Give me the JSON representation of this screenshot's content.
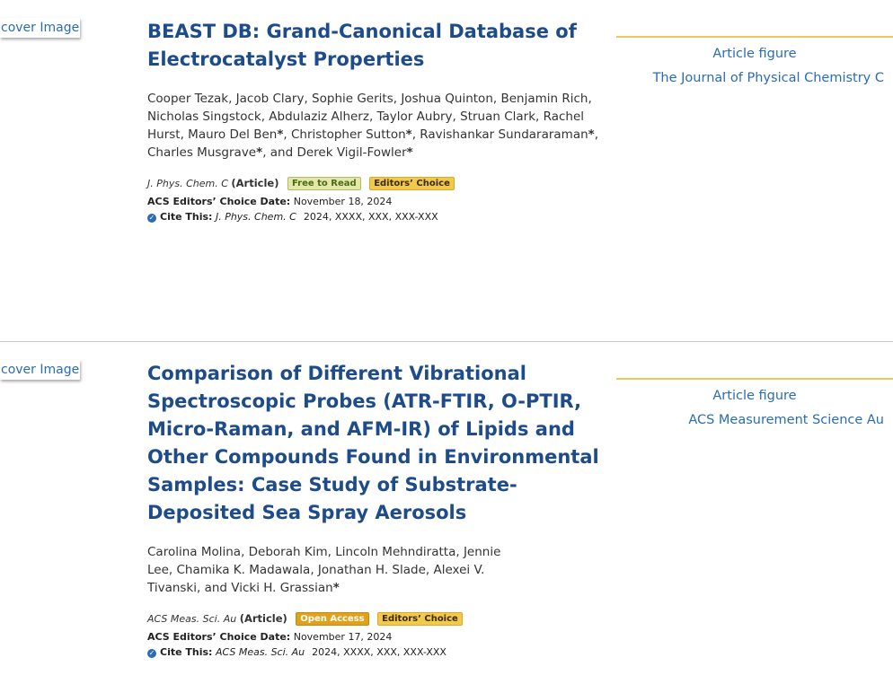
{
  "articles": [
    {
      "cover_alt": "cover Image",
      "title": "BEAST DB: Grand-Canonical Database of Electrocatalyst Properties",
      "authors": [
        {
          "text": "Cooper Tezak, Jacob Clary, Sophie Gerits, Joshua Quinton, Benjamin Rich, Nicholas Singstock, Abdulaziz Alherz, Taylor Aubry, Struan Clark, Rachel Hurst, Mauro Del Ben",
          "star": "*"
        },
        {
          "text": ", Christopher Sutton",
          "star": "*"
        },
        {
          "text": ", Ravishankar Sundararaman",
          "star": "*"
        },
        {
          "text": ", Charles Musgrave",
          "star": "*"
        },
        {
          "text": ", and Derek Vigil-Fowler",
          "star": "*"
        }
      ],
      "journal": "J. Phys. Chem. C",
      "article_type": "(Article)",
      "access_badge": "Free to Read",
      "access_kind": "free",
      "choice_badge": "Editors’ Choice",
      "ec_date_label": "ACS Editors’ Choice Date:",
      "ec_date": "November 18, 2024",
      "cite_label": "Cite This:",
      "cite_journal": "J. Phys. Chem. C",
      "cite_rest": "2024, XXXX, XXX, XXX-XXX",
      "figure_alt": "Article figure",
      "journal_img_alt": "The Journal of Physical Chemistry C"
    },
    {
      "cover_alt": "cover Image",
      "title": "Comparison of Different Vibrational Spectroscopic Probes (ATR-FTIR, O-PTIR, Micro-Raman, and AFM-IR) of Lipids and Other Compounds Found in Environmental Samples: Case Study of Substrate-Deposited Sea Spray Aerosols",
      "authors": [
        {
          "text": "Carolina Molina, Deborah Kim, Lincoln Mehndiratta, Jennie Lee, Chamika K. Madawala, Jonathan H. Slade, Alexei V. Tivanski, and Vicki H. Grassian",
          "star": "*"
        }
      ],
      "journal": "ACS Meas. Sci. Au",
      "article_type": "(Article)",
      "access_badge": "Open Access",
      "access_kind": "oa",
      "choice_badge": "Editors’ Choice",
      "ec_date_label": "ACS Editors’ Choice Date:",
      "ec_date": "November 17, 2024",
      "cite_label": "Cite This:",
      "cite_journal": "ACS Meas. Sci. Au",
      "cite_rest": "2024, XXXX, XXX, XXX-XXX",
      "figure_alt": "Article figure",
      "journal_img_alt": "ACS Measurement Science Au"
    }
  ],
  "colors": {
    "title": "#1e4c8a",
    "link": "#2a6cb3",
    "rule": "#f0c85a"
  }
}
